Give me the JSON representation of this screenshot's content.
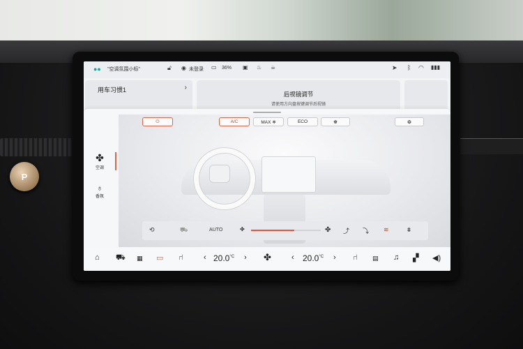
{
  "status_bar": {
    "profile": "\"空调氛围小标\"",
    "mode": "未登录",
    "battery": "36%"
  },
  "top_cards": {
    "habit_title": "用车习惯1",
    "mirror_title": "后视镜调节",
    "mirror_subtitle": "请使用方向盘按键调节后视镜"
  },
  "sidebar": {
    "items": [
      {
        "label": "空调",
        "icon": "fan-icon",
        "active": true
      },
      {
        "label": "香氛",
        "icon": "perfume-icon",
        "active": false
      }
    ]
  },
  "climate": {
    "power_label": "⏻",
    "buttons": [
      {
        "label": "A/C",
        "active": true
      },
      {
        "label": "MAX ❄",
        "active": false
      },
      {
        "label": "ECO",
        "active": false
      },
      {
        "label": "☸",
        "active": false
      }
    ],
    "sync_label": "❂",
    "fan": {
      "mode_label": "AUTO",
      "level": 0.62
    }
  },
  "dock": {
    "left_temp": "20.0",
    "right_temp": "20.0",
    "temp_unit": "°C",
    "prev_glyph": "‹",
    "next_glyph": "›"
  },
  "accent_color": "#d9684a"
}
